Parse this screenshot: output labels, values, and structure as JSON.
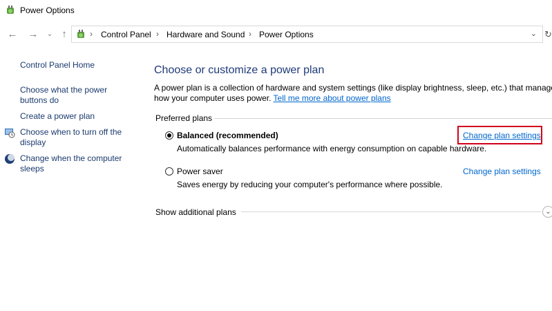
{
  "window": {
    "title": "Power Options"
  },
  "nav": {
    "back_icon": "back-arrow-icon",
    "forward_icon": "forward-arrow-icon",
    "recent_icon": "chevron-down-icon",
    "up_icon": "up-arrow-icon"
  },
  "address": {
    "breadcrumbs": [
      "Control Panel",
      "Hardware and Sound",
      "Power Options"
    ]
  },
  "sidebar": {
    "home": "Control Panel Home",
    "links": [
      "Choose what the power buttons do",
      "Create a power plan",
      "Choose when to turn off the display",
      "Change when the computer sleeps"
    ]
  },
  "main": {
    "heading": "Choose or customize a power plan",
    "description": "A power plan is a collection of hardware and system settings (like display brightness, sleep, etc.) that manages how your computer uses power.",
    "tell_more": "Tell me more about power plans",
    "preferred_label": "Preferred plans",
    "plans": [
      {
        "name": "Balanced (recommended)",
        "desc": "Automatically balances performance with energy consumption on capable hardware.",
        "link": "Change plan settings",
        "selected": true
      },
      {
        "name": "Power saver",
        "desc": "Saves energy by reducing your computer's performance where possible.",
        "link": "Change plan settings",
        "selected": false
      }
    ],
    "show_additional": "Show additional plans"
  },
  "colors": {
    "link": "#0066cc",
    "heading": "#1e3a78",
    "highlight": "#d0021b"
  }
}
